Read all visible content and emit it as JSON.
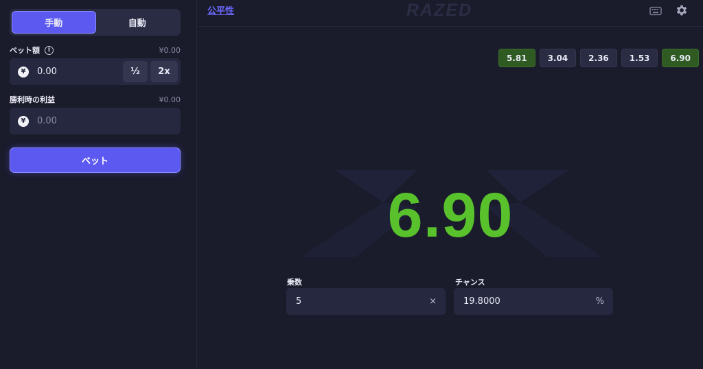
{
  "sidebar": {
    "mode_tabs": [
      {
        "label": "手動",
        "active": true
      },
      {
        "label": "自動",
        "active": false
      }
    ],
    "bet_amount": {
      "label": "ベット額",
      "aside": "¥0.00",
      "currency_symbol": "¥",
      "value": "0.00",
      "half_label": "½",
      "double_label": "2x"
    },
    "profit_on_win": {
      "label": "勝利時の利益",
      "aside": "¥0.00",
      "currency_symbol": "¥",
      "placeholder": "0.00"
    },
    "bet_button_label": "ベット"
  },
  "topbar": {
    "fairness_link": "公平性",
    "brand": "RAZED",
    "icons": [
      "keyboard-icon",
      "gear-icon"
    ]
  },
  "history": [
    {
      "value": "5.81",
      "win": true
    },
    {
      "value": "3.04",
      "win": false
    },
    {
      "value": "2.36",
      "win": false
    },
    {
      "value": "1.53",
      "win": false
    },
    {
      "value": "6.90",
      "win": true
    }
  ],
  "result": "6.90",
  "params": {
    "multiplier": {
      "label": "乗数",
      "value": "5",
      "suffix": "×"
    },
    "chance": {
      "label": "チャンス",
      "value": "19.8000",
      "suffix": "%"
    }
  },
  "colors": {
    "background": "#1a1b2b",
    "panel": "#262840",
    "accent": "#5b59f0",
    "win_green": "#58c12c",
    "win_chip": "#2f5a22"
  }
}
